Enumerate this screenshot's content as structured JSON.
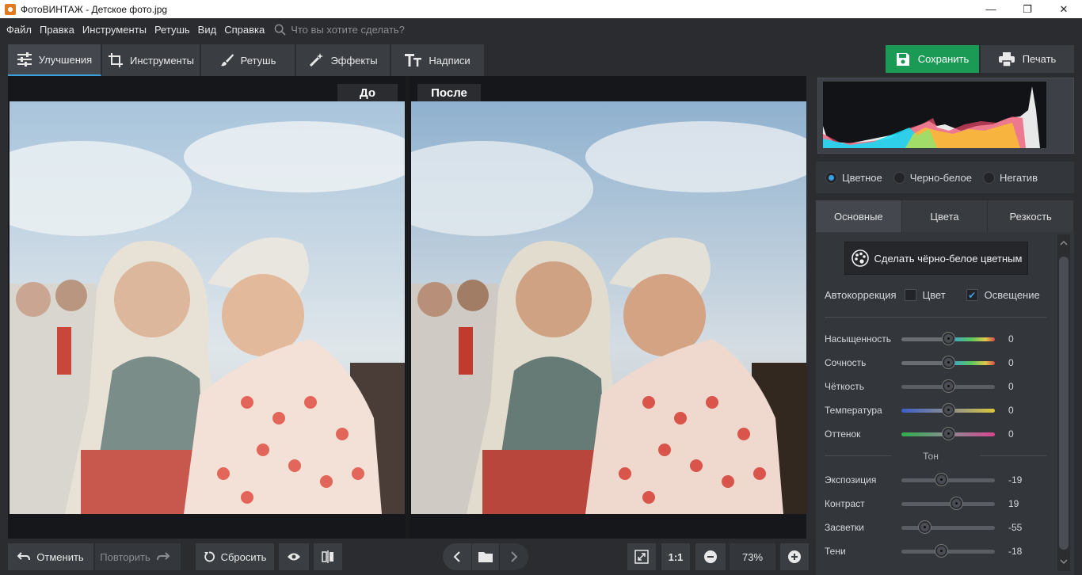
{
  "window": {
    "title": "ФотоВИНТАЖ - Детское фото.jpg",
    "minimize": "—",
    "maximize": "❐",
    "close": "✕"
  },
  "menu": {
    "items": [
      "Файл",
      "Правка",
      "Инструменты",
      "Ретушь",
      "Вид",
      "Справка"
    ],
    "search_placeholder": "Что вы хотите сделать?"
  },
  "tabs": [
    {
      "label": "Улучшения",
      "icon": "sliders-icon",
      "active": true
    },
    {
      "label": "Инструменты",
      "icon": "crop-icon"
    },
    {
      "label": "Ретушь",
      "icon": "brush-icon"
    },
    {
      "label": "Эффекты",
      "icon": "magic-wand-icon"
    },
    {
      "label": "Надписи",
      "icon": "text-icon"
    }
  ],
  "actions": {
    "save": "Сохранить",
    "print": "Печать"
  },
  "compare": {
    "before": "До",
    "after": "После"
  },
  "bottom": {
    "undo": "Отменить",
    "redo": "Повторить",
    "reset": "Сбросить",
    "zoom_1_1": "1:1",
    "zoom": "73%"
  },
  "mode": {
    "options": [
      "Цветное",
      "Черно-белое",
      "Негатив"
    ],
    "selected": "Цветное"
  },
  "subtabs": [
    {
      "label": "Основные",
      "active": true
    },
    {
      "label": "Цвета"
    },
    {
      "label": "Резкость"
    }
  ],
  "colorize_button": "Сделать чёрно-белое цветным",
  "autocorrection": {
    "label": "Автокоррекция",
    "color": {
      "label": "Цвет",
      "checked": false
    },
    "light": {
      "label": "Освещение",
      "checked": true
    }
  },
  "sliders": [
    {
      "name": "Насыщенность",
      "value": "0",
      "level": 0.5
    },
    {
      "name": "Сочность",
      "value": "0",
      "level": 0.5
    },
    {
      "name": "Чёткость",
      "value": "0",
      "level": 0.5
    },
    {
      "name": "Температура",
      "value": "0",
      "level": 0.5
    },
    {
      "name": "Оттенок",
      "value": "0",
      "level": 0.5
    }
  ],
  "tone": {
    "header": "Тон",
    "sliders": [
      {
        "name": "Экспозиция",
        "value": "-19",
        "level": 0.43
      },
      {
        "name": "Контраст",
        "value": "19",
        "level": 0.59
      },
      {
        "name": "Засветки",
        "value": "-55",
        "level": 0.25
      },
      {
        "name": "Тени",
        "value": "-18",
        "level": 0.43
      }
    ]
  },
  "colors": {
    "accent": "#3aa0e0",
    "save": "#1b9a55"
  }
}
